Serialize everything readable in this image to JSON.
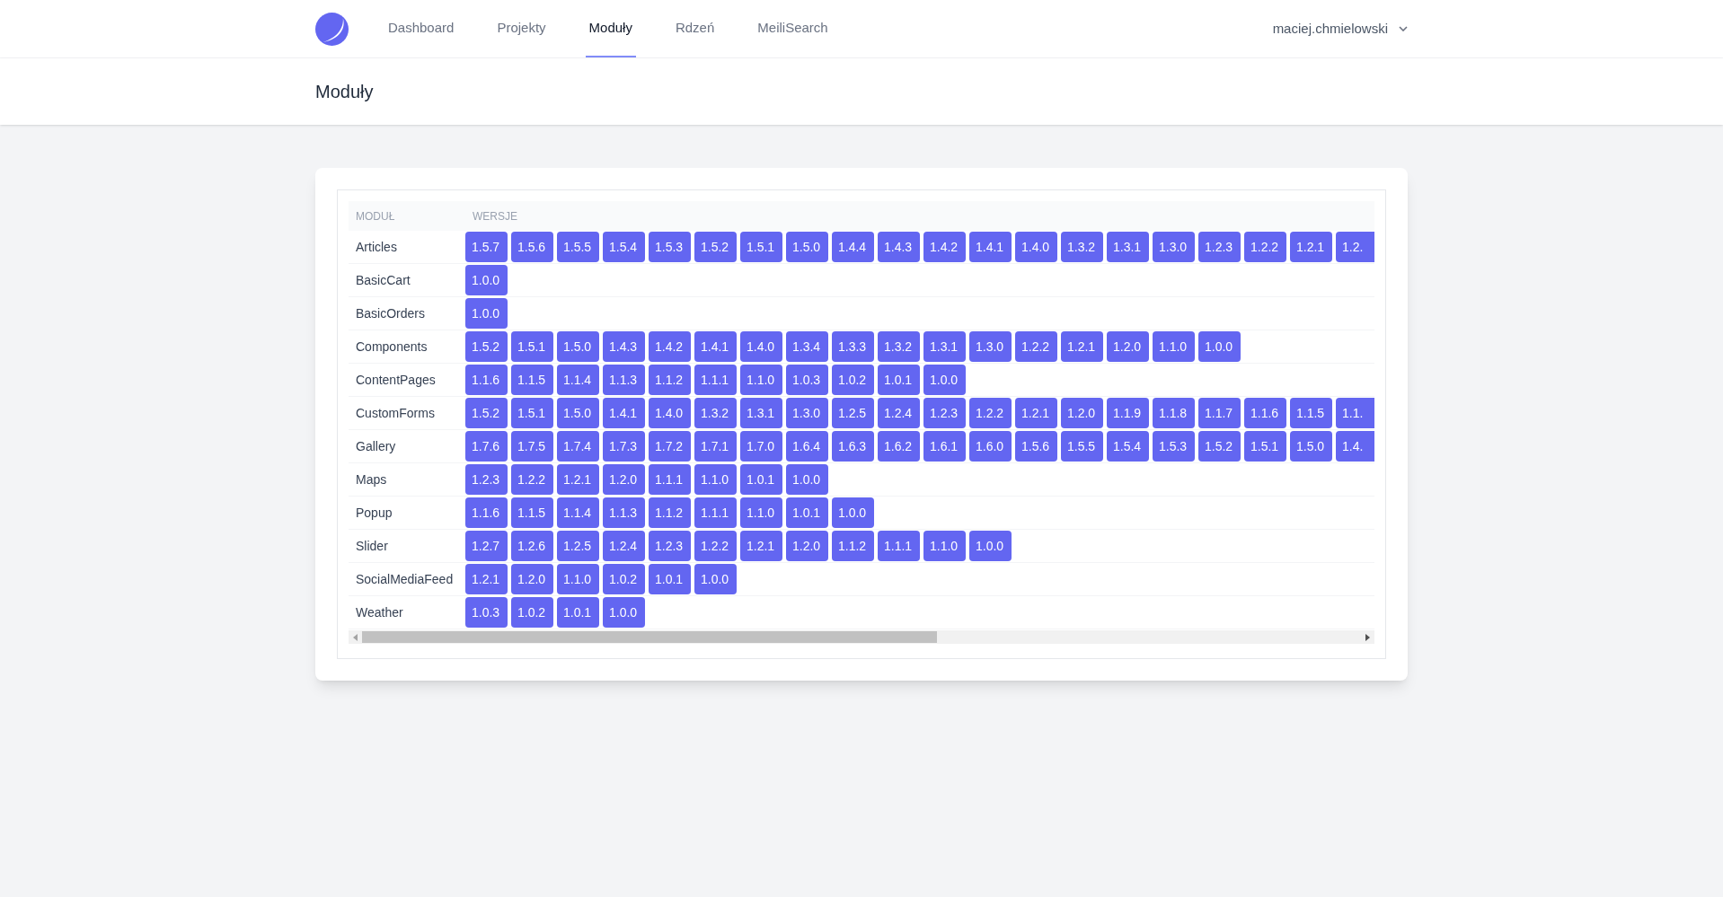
{
  "nav": {
    "links": [
      {
        "label": "Dashboard",
        "selected": false
      },
      {
        "label": "Projekty",
        "selected": false
      },
      {
        "label": "Moduły",
        "selected": true
      },
      {
        "label": "Rdzeń",
        "selected": false
      },
      {
        "label": "MeiliSearch",
        "selected": false
      }
    ],
    "user": {
      "name": "maciej.chmielowski"
    }
  },
  "page_title": "Moduły",
  "table": {
    "columns": [
      "MODUŁ",
      "WERSJE"
    ],
    "rows": [
      {
        "module": "Articles",
        "versions": [
          "1.5.7",
          "1.5.6",
          "1.5.5",
          "1.5.4",
          "1.5.3",
          "1.5.2",
          "1.5.1",
          "1.5.0",
          "1.4.4",
          "1.4.3",
          "1.4.2",
          "1.4.1",
          "1.4.0",
          "1.3.2",
          "1.3.1",
          "1.3.0",
          "1.2.3",
          "1.2.2",
          "1.2.1",
          "1.2."
        ]
      },
      {
        "module": "BasicCart",
        "versions": [
          "1.0.0"
        ]
      },
      {
        "module": "BasicOrders",
        "versions": [
          "1.0.0"
        ]
      },
      {
        "module": "Components",
        "versions": [
          "1.5.2",
          "1.5.1",
          "1.5.0",
          "1.4.3",
          "1.4.2",
          "1.4.1",
          "1.4.0",
          "1.3.4",
          "1.3.3",
          "1.3.2",
          "1.3.1",
          "1.3.0",
          "1.2.2",
          "1.2.1",
          "1.2.0",
          "1.1.0",
          "1.0.0"
        ]
      },
      {
        "module": "ContentPages",
        "versions": [
          "1.1.6",
          "1.1.5",
          "1.1.4",
          "1.1.3",
          "1.1.2",
          "1.1.1",
          "1.1.0",
          "1.0.3",
          "1.0.2",
          "1.0.1",
          "1.0.0"
        ]
      },
      {
        "module": "CustomForms",
        "versions": [
          "1.5.2",
          "1.5.1",
          "1.5.0",
          "1.4.1",
          "1.4.0",
          "1.3.2",
          "1.3.1",
          "1.3.0",
          "1.2.5",
          "1.2.4",
          "1.2.3",
          "1.2.2",
          "1.2.1",
          "1.2.0",
          "1.1.9",
          "1.1.8",
          "1.1.7",
          "1.1.6",
          "1.1.5",
          "1.1."
        ]
      },
      {
        "module": "Gallery",
        "versions": [
          "1.7.6",
          "1.7.5",
          "1.7.4",
          "1.7.3",
          "1.7.2",
          "1.7.1",
          "1.7.0",
          "1.6.4",
          "1.6.3",
          "1.6.2",
          "1.6.1",
          "1.6.0",
          "1.5.6",
          "1.5.5",
          "1.5.4",
          "1.5.3",
          "1.5.2",
          "1.5.1",
          "1.5.0",
          "1.4."
        ]
      },
      {
        "module": "Maps",
        "versions": [
          "1.2.3",
          "1.2.2",
          "1.2.1",
          "1.2.0",
          "1.1.1",
          "1.1.0",
          "1.0.1",
          "1.0.0"
        ]
      },
      {
        "module": "Popup",
        "versions": [
          "1.1.6",
          "1.1.5",
          "1.1.4",
          "1.1.3",
          "1.1.2",
          "1.1.1",
          "1.1.0",
          "1.0.1",
          "1.0.0"
        ]
      },
      {
        "module": "Slider",
        "versions": [
          "1.2.7",
          "1.2.6",
          "1.2.5",
          "1.2.4",
          "1.2.3",
          "1.2.2",
          "1.2.1",
          "1.2.0",
          "1.1.2",
          "1.1.1",
          "1.1.0",
          "1.0.0"
        ]
      },
      {
        "module": "SocialMediaFeed",
        "versions": [
          "1.2.1",
          "1.2.0",
          "1.1.0",
          "1.0.2",
          "1.0.1",
          "1.0.0"
        ]
      },
      {
        "module": "Weather",
        "versions": [
          "1.0.3",
          "1.0.2",
          "1.0.1",
          "1.0.0"
        ]
      }
    ]
  }
}
